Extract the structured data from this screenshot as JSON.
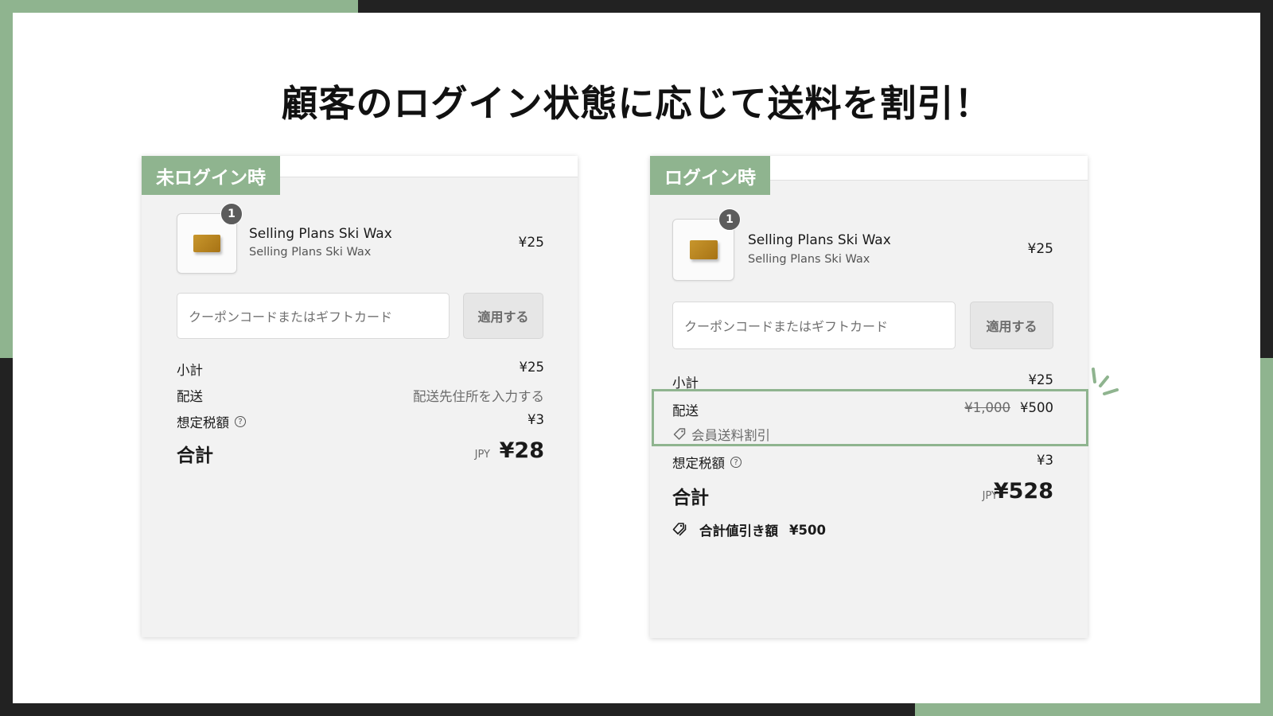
{
  "headline": "顧客のログイン状態に応じて送料を割引！",
  "colors": {
    "accent_green": "#8fb48f",
    "frame_dark": "#222222",
    "panel_bg": "#f2f2f2"
  },
  "panels": {
    "guest": {
      "tag": "未ログイン時",
      "item": {
        "quantity": "1",
        "name": "Selling Plans Ski Wax",
        "variant": "Selling Plans Ski Wax",
        "price": "¥25"
      },
      "coupon_placeholder": "クーポンコードまたはギフトカード",
      "apply_label": "適用する",
      "subtotal_label": "小計",
      "subtotal_value": "¥25",
      "shipping_label": "配送",
      "shipping_value": "配送先住所を入力する",
      "tax_label": "想定税額",
      "tax_value": "¥3",
      "total_label": "合計",
      "currency": "JPY",
      "total_value": "¥28"
    },
    "member": {
      "tag": "ログイン時",
      "item": {
        "quantity": "1",
        "name": "Selling Plans Ski Wax",
        "variant": "Selling Plans Ski Wax",
        "price": "¥25"
      },
      "coupon_placeholder": "クーポンコードまたはギフトカード",
      "apply_label": "適用する",
      "subtotal_label": "小計",
      "subtotal_value": "¥25",
      "shipping_label": "配送",
      "shipping_original": "¥1,000",
      "shipping_value": "¥500",
      "discount_name": "会員送料割引",
      "tax_label": "想定税額",
      "tax_value": "¥3",
      "total_label": "合計",
      "currency": "JPY",
      "total_value": "¥528",
      "savings_label": "合計値引き額",
      "savings_value": "¥500"
    }
  },
  "icons": {
    "help": "question-circle-icon",
    "tag": "tag-icon",
    "tags": "tags-icon"
  }
}
